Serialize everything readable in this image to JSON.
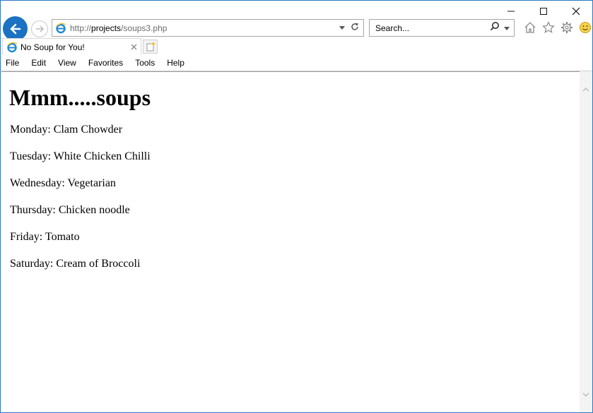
{
  "browser": {
    "address_url_prefix": "http://",
    "address_url_host": "projects",
    "address_url_path": "/soups3.php",
    "search_placeholder": "Search...",
    "tab_title": "No Soup for You!",
    "menu": [
      "File",
      "Edit",
      "View",
      "Favorites",
      "Tools",
      "Help"
    ]
  },
  "page": {
    "heading": "Mmm.....soups",
    "soups": [
      "Monday: Clam Chowder",
      "Tuesday: White Chicken Chilli",
      "Wednesday: Vegetarian",
      "Thursday: Chicken noodle",
      "Friday: Tomato",
      "Saturday: Cream of Broccoli"
    ]
  },
  "colors": {
    "accent": "#1b71c2",
    "window_border": "#2b79c4"
  },
  "icons": [
    "minimize-icon",
    "maximize-icon",
    "close-icon",
    "back-arrow-icon",
    "forward-arrow-icon",
    "ie-logo-icon",
    "dropdown-icon",
    "refresh-icon",
    "search-icon",
    "home-icon",
    "favorites-star-icon",
    "settings-gear-icon",
    "smiley-feedback-icon",
    "tab-close-icon",
    "new-tab-icon",
    "scroll-up-icon",
    "scroll-down-icon"
  ]
}
